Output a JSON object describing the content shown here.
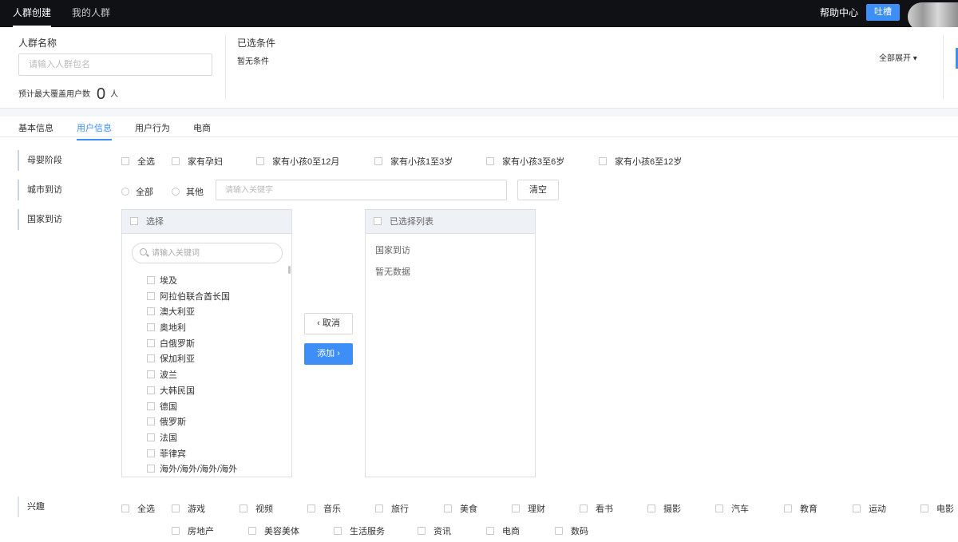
{
  "topbar": {
    "tabs": [
      "人群创建",
      "我的人群"
    ],
    "help": "帮助中心",
    "feedback": "吐槽"
  },
  "header": {
    "name_label": "人群名称",
    "name_placeholder": "请输入人群包名",
    "estimate_label": "预计最大覆盖用户数",
    "estimate_value": "0",
    "estimate_unit": "人",
    "selected_title": "已选条件",
    "selected_empty": "暂无条件",
    "expand_all": "全部展开 ▾"
  },
  "tabs": [
    "基本信息",
    "用户信息",
    "用户行为",
    "电商"
  ],
  "active_tab": "用户信息",
  "mother": {
    "label": "母婴阶段",
    "options": [
      "全选",
      "家有孕妇",
      "家有小孩0至12月",
      "家有小孩1至3岁",
      "家有小孩3至6岁",
      "家有小孩6至12岁"
    ]
  },
  "city": {
    "label": "城市到访",
    "radios": [
      "全部",
      "其他"
    ],
    "keyword_placeholder": "请输入关键字",
    "clear": "清空"
  },
  "country": {
    "label": "国家到访",
    "left_head": "选择",
    "search_placeholder": "请输入关键词",
    "items": [
      "埃及",
      "阿拉伯联合酋长国",
      "澳大利亚",
      "奥地利",
      "白俄罗斯",
      "保加利亚",
      "波兰",
      "大韩民国",
      "德国",
      "俄罗斯",
      "法国",
      "菲律宾",
      "海外/海外/海外/海外"
    ],
    "right_head": "已选择列表",
    "right_sub": "国家到访",
    "right_empty": "暂无数据",
    "cancel": "取消",
    "add": "添加"
  },
  "interest": {
    "label": "兴趣",
    "row1": [
      "全选",
      "游戏",
      "视频",
      "音乐",
      "旅行",
      "美食",
      "理财",
      "看书",
      "摄影",
      "汽车",
      "教育",
      "运动",
      "电影"
    ],
    "row2": [
      "房地产",
      "美容美体",
      "生活服务",
      "资讯",
      "电商",
      "数码"
    ]
  },
  "colors": {
    "accent": "#3e8ef7",
    "topbar": "#0f1114"
  }
}
